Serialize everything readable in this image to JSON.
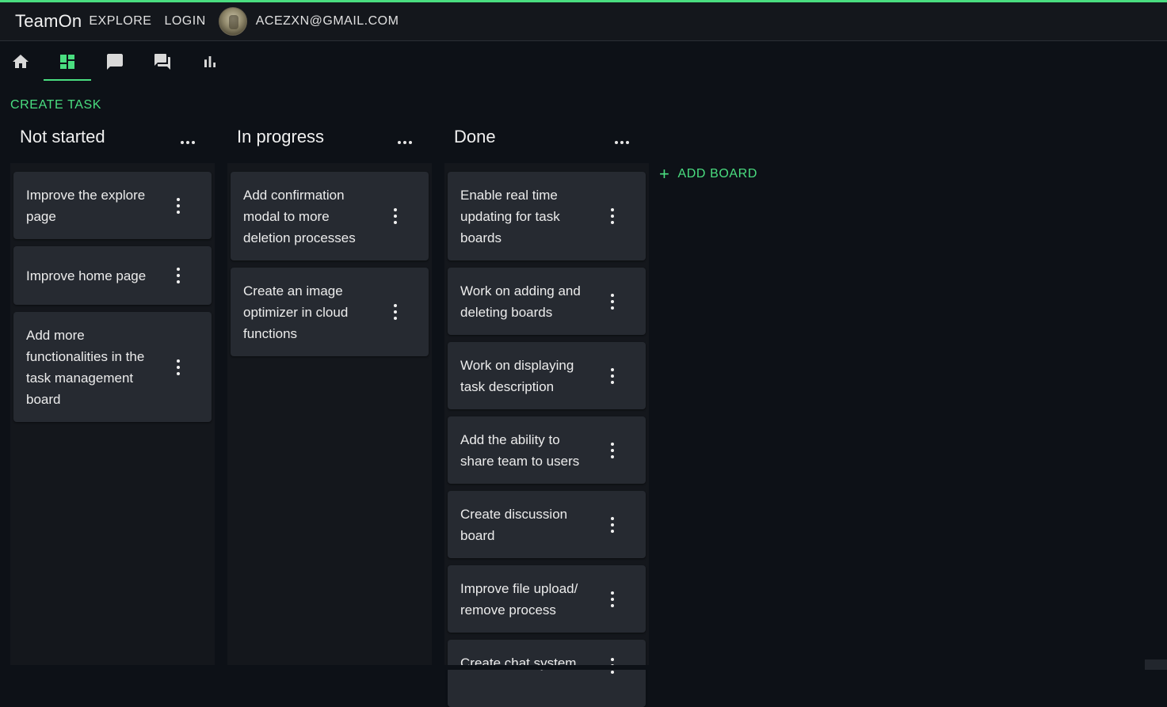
{
  "app": {
    "brand": "TeamOn",
    "nav": {
      "explore": "EXPLORE",
      "login": "LOGIN"
    },
    "user_email": "ACEZXN@GMAIL.COM",
    "accent_color": "#4ade80"
  },
  "icons": [
    "home-icon",
    "dashboard-icon",
    "chat-bubble-icon",
    "forum-icon",
    "bar-chart-icon"
  ],
  "actions": {
    "create_task": "CREATE TASK",
    "add_board_plus": "+",
    "add_board": "ADD BOARD"
  },
  "boards": [
    {
      "title": "Not started",
      "cards": [
        "Improve the explore page",
        "Improve home page",
        "Add more functionalities in the task management board"
      ]
    },
    {
      "title": "In progress",
      "cards": [
        "Add confirmation modal to more deletion processes",
        "Create an image optimizer in cloud functions"
      ]
    },
    {
      "title": "Done",
      "cards": [
        "Enable real time updating for task boards",
        "Work on adding and deleting boards",
        "Work on displaying task description",
        "Add the ability to share team to users",
        "Create discussion board",
        "Improve file upload/ remove process",
        "Create chat system"
      ]
    }
  ]
}
